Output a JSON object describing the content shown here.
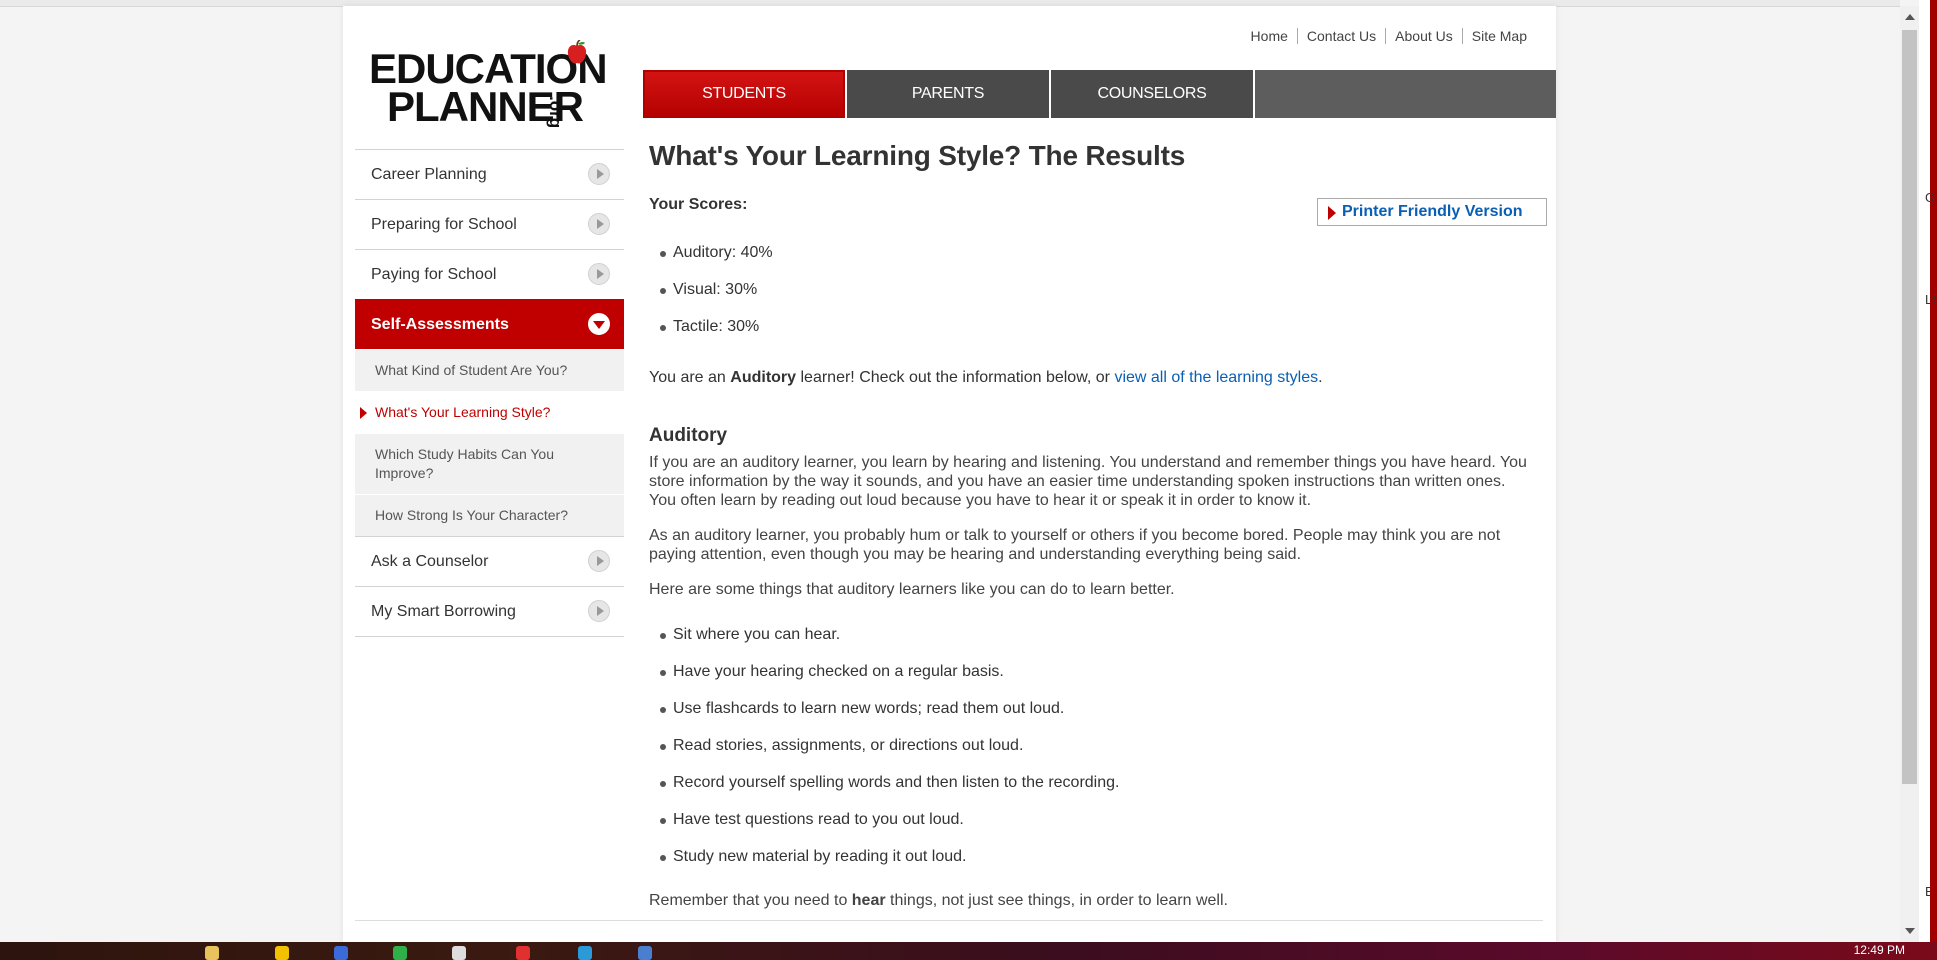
{
  "site": {
    "logo_line1": "EDUCATION",
    "logo_line2": "PLANNER",
    "logo_suffix": ".org"
  },
  "utility_nav": [
    "Home",
    "Contact Us",
    "About Us",
    "Site Map"
  ],
  "tabs": [
    {
      "label": "STUDENTS",
      "active": true
    },
    {
      "label": "PARENTS",
      "active": false
    },
    {
      "label": "COUNSELORS",
      "active": false
    }
  ],
  "sidebar": {
    "items": [
      {
        "label": "Career Planning"
      },
      {
        "label": "Preparing for School"
      },
      {
        "label": "Paying for School"
      },
      {
        "label": "Self-Assessments"
      }
    ],
    "subitems": [
      {
        "label": "What Kind of Student Are You?"
      },
      {
        "label": "What's Your Learning Style?"
      },
      {
        "label": "Which Study Habits Can You Improve?"
      },
      {
        "label": "How Strong Is Your Character?"
      }
    ],
    "bottom_items": [
      {
        "label": "Ask a Counselor"
      },
      {
        "label": "My Smart Borrowing"
      }
    ]
  },
  "main": {
    "title": "What's Your Learning Style? The Results",
    "scores_label": "Your Scores:",
    "printer_label": "Printer Friendly Version",
    "scores": [
      "Auditory: 40%",
      "Visual: 30%",
      "Tactile: 30%"
    ],
    "learner_prefix": "You are an ",
    "learner_type": "Auditory",
    "learner_mid": " learner! Check out the information below, or ",
    "learner_link": "view all of the learning styles",
    "learner_end": ".",
    "section_title": "Auditory",
    "para1": "If you are an auditory learner, you learn by hearing and listening. You understand and remember things you have heard. You store information by the way it sounds, and you have an easier time understanding spoken instructions than written ones. You often learn by reading out loud because you have to hear it or speak it in order to know it.",
    "para2": "As an auditory learner, you probably hum or talk to yourself or others if you become bored. People may think you are not paying attention, even though you may be hearing and understanding everything being said.",
    "para3": "Here are some things that auditory learners like you can do to learn better.",
    "tips": [
      "Sit where you can hear.",
      "Have your hearing checked on a regular basis.",
      "Use flashcards to learn new words; read them out loud.",
      "Read stories, assignments, or directions out loud.",
      "Record yourself spelling words and then listen to the recording.",
      "Have test questions read to you out loud.",
      "Study new material by reading it out loud."
    ],
    "closing_prefix": "Remember that you need to ",
    "closing_bold": "hear",
    "closing_suffix": " things, not just see things, in order to learn well."
  },
  "edge_text": [
    "G",
    "LS",
    "E"
  ],
  "taskbar": {
    "clock": "12:49 PM"
  },
  "colors": {
    "brand_red": "#c00000",
    "link_blue": "#0a5fb4",
    "tab_gray": "#4a4a4a"
  }
}
